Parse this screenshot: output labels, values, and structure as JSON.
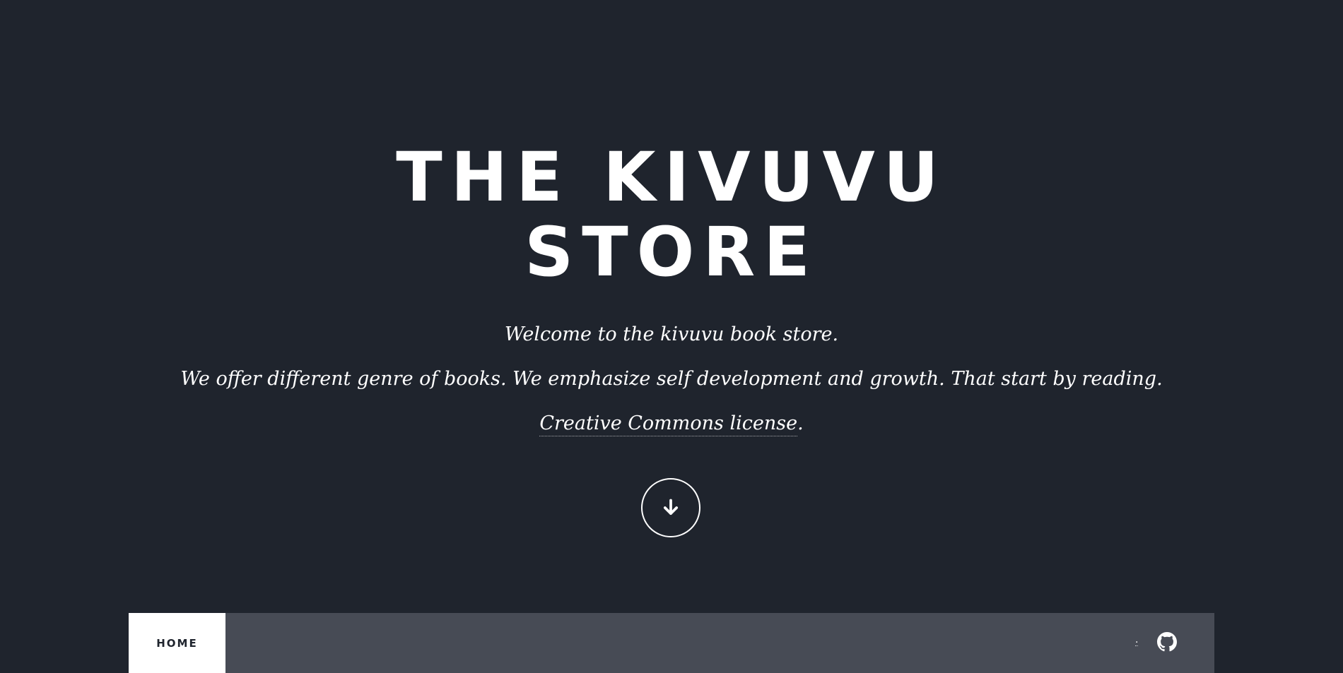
{
  "hero": {
    "title_line1": "THE KIVUVU",
    "title_line2": "STORE",
    "tagline1": "Welcome to the kivuvu book store.",
    "tagline2": "We offer different genre of books. We emphasize self development and growth. That start by reading.",
    "license_link": "Creative Commons license",
    "license_suffix": ".",
    "scroll_icon": "arrow-down-icon"
  },
  "navbar": {
    "home_label": "HOME",
    "dot_link": ".",
    "github_icon": "github-icon"
  },
  "colors": {
    "background": "#1f242d",
    "navbar": "#474b55",
    "text": "#ffffff"
  }
}
